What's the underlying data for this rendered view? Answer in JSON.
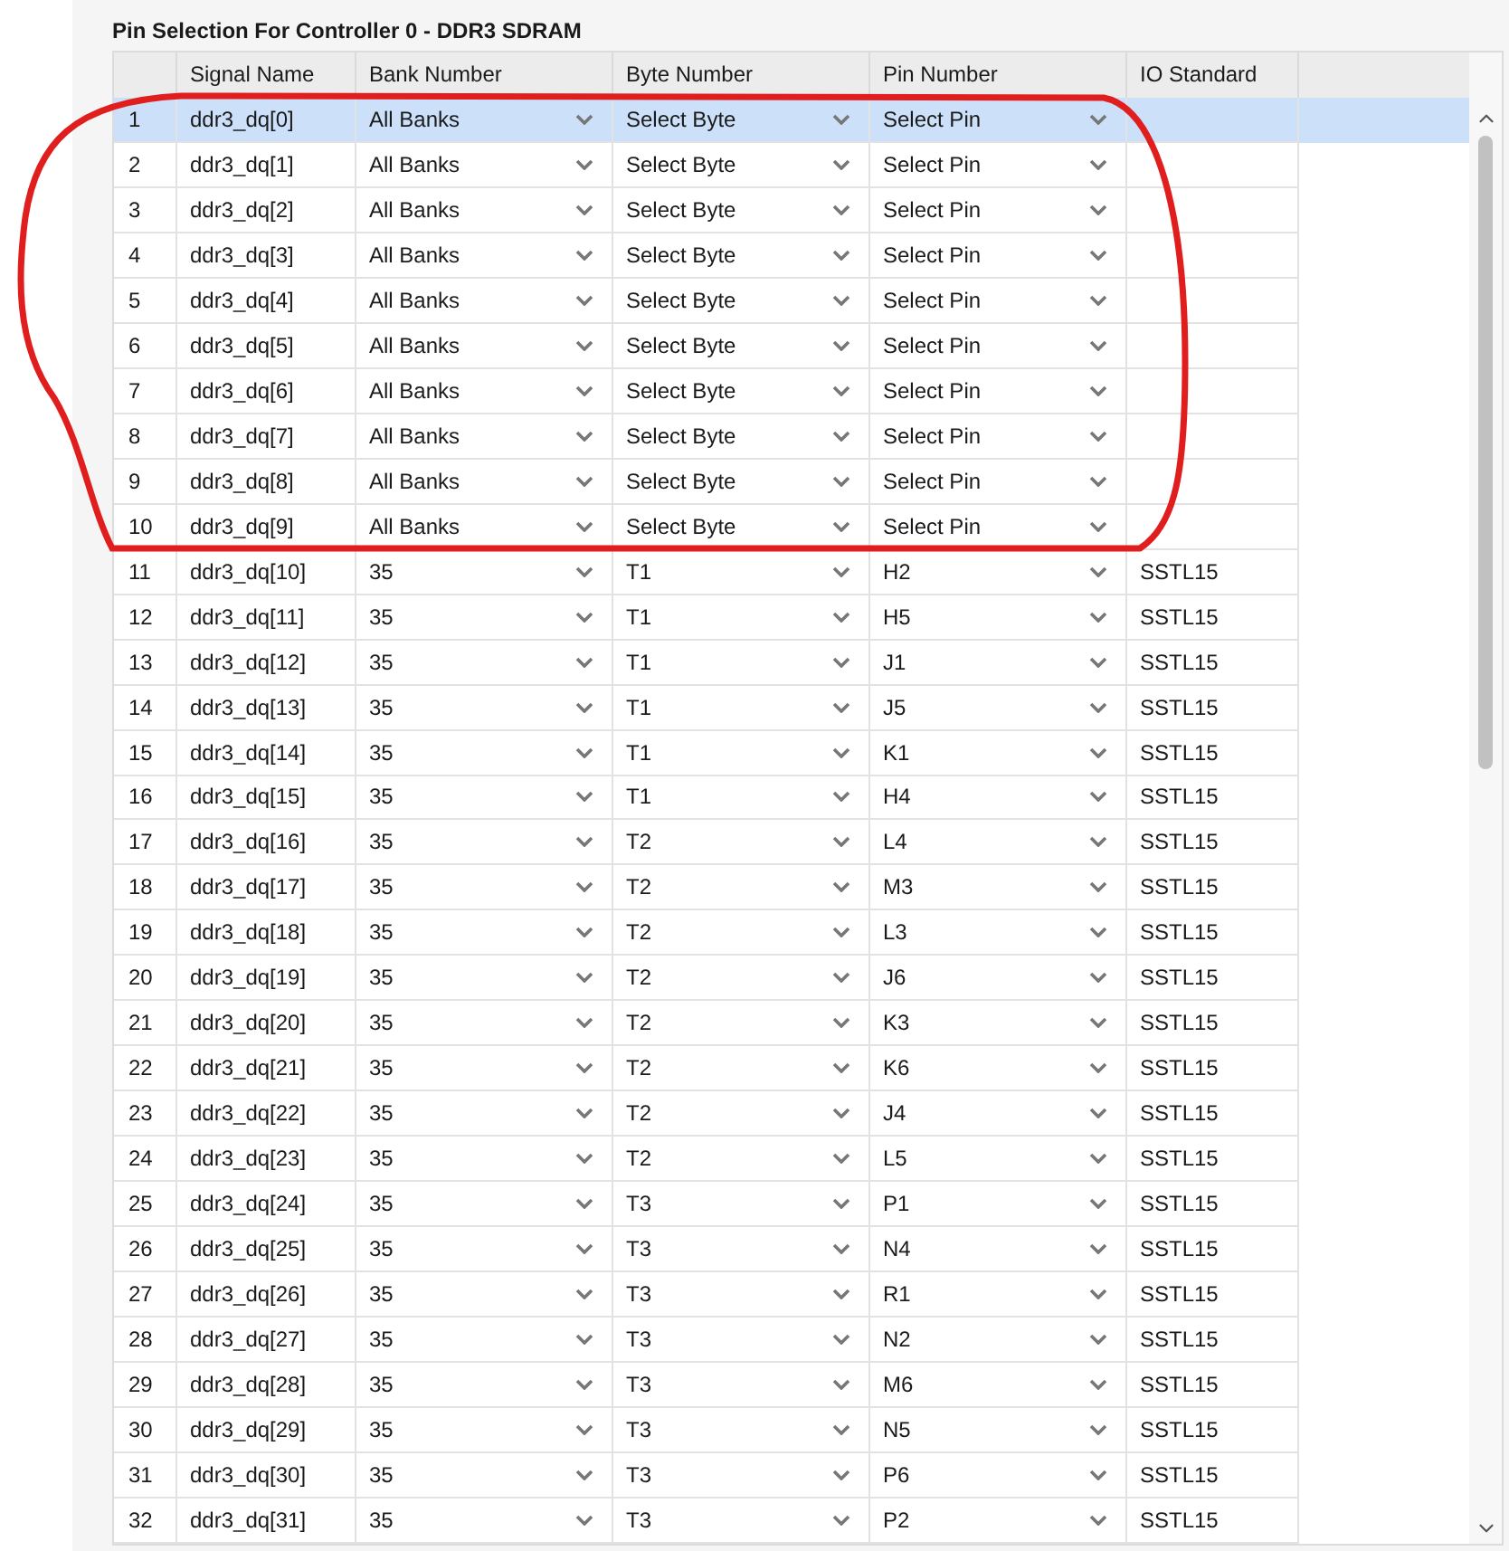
{
  "title": "Pin Selection For Controller 0 - DDR3 SDRAM",
  "columns": [
    "Signal Name",
    "Bank Number",
    "Byte Number",
    "Pin Number",
    "IO Standard"
  ],
  "rows": [
    {
      "index": "1",
      "signal": "ddr3_dq[0]",
      "bank": "All Banks",
      "byte": "Select Byte",
      "pin": "Select Pin",
      "selected": true
    },
    {
      "index": "2",
      "signal": "ddr3_dq[1]",
      "bank": "All Banks",
      "byte": "Select Byte",
      "pin": "Select Pin",
      "selected": false
    },
    {
      "index": "3",
      "signal": "ddr3_dq[2]",
      "bank": "All Banks",
      "byte": "Select Byte",
      "pin": "Select Pin",
      "selected": false
    },
    {
      "index": "4",
      "signal": "ddr3_dq[3]",
      "bank": "All Banks",
      "byte": "Select Byte",
      "pin": "Select Pin",
      "selected": false
    },
    {
      "index": "5",
      "signal": "ddr3_dq[4]",
      "bank": "All Banks",
      "byte": "Select Byte",
      "pin": "Select Pin",
      "selected": false
    },
    {
      "index": "6",
      "signal": "ddr3_dq[5]",
      "bank": "All Banks",
      "byte": "Select Byte",
      "pin": "Select Pin",
      "selected": false
    },
    {
      "index": "7",
      "signal": "ddr3_dq[6]",
      "bank": "All Banks",
      "byte": "Select Byte",
      "pin": "Select Pin",
      "selected": false
    },
    {
      "index": "8",
      "signal": "ddr3_dq[7]",
      "bank": "All Banks",
      "byte": "Select Byte",
      "pin": "Select Pin",
      "selected": false
    },
    {
      "index": "9",
      "signal": "ddr3_dq[8]",
      "bank": "All Banks",
      "byte": "Select Byte",
      "pin": "Select Pin",
      "selected": false
    },
    {
      "index": "10",
      "signal": "ddr3_dq[9]",
      "bank": "All Banks",
      "byte": "Select Byte",
      "pin": "Select Pin",
      "selected": false
    },
    {
      "index": "11",
      "signal": "ddr3_dq[10]",
      "bank": "35",
      "byte": "T1",
      "pin": "H2",
      "io_standard": "SSTL15",
      "selected": false
    },
    {
      "index": "12",
      "signal": "ddr3_dq[11]",
      "bank": "35",
      "byte": "T1",
      "pin": "H5",
      "io_standard": "SSTL15",
      "selected": false
    },
    {
      "index": "13",
      "signal": "ddr3_dq[12]",
      "bank": "35",
      "byte": "T1",
      "pin": "J1",
      "io_standard": "SSTL15",
      "selected": false
    },
    {
      "index": "14",
      "signal": "ddr3_dq[13]",
      "bank": "35",
      "byte": "T1",
      "pin": "J5",
      "io_standard": "SSTL15",
      "selected": false
    },
    {
      "index": "15",
      "signal": "ddr3_dq[14]",
      "bank": "35",
      "byte": "T1",
      "pin": "K1",
      "io_standard": "SSTL15",
      "selected": false
    },
    {
      "index": "16",
      "signal": "ddr3_dq[15]",
      "bank": "35",
      "byte": "T1",
      "pin": "H4",
      "io_standard": "SSTL15",
      "selected": false
    },
    {
      "index": "17",
      "signal": "ddr3_dq[16]",
      "bank": "35",
      "byte": "T2",
      "pin": "L4",
      "io_standard": "SSTL15",
      "selected": false
    },
    {
      "index": "18",
      "signal": "ddr3_dq[17]",
      "bank": "35",
      "byte": "T2",
      "pin": "M3",
      "io_standard": "SSTL15",
      "selected": false
    },
    {
      "index": "19",
      "signal": "ddr3_dq[18]",
      "bank": "35",
      "byte": "T2",
      "pin": "L3",
      "io_standard": "SSTL15",
      "selected": false
    },
    {
      "index": "20",
      "signal": "ddr3_dq[19]",
      "bank": "35",
      "byte": "T2",
      "pin": "J6",
      "io_standard": "SSTL15",
      "selected": false
    },
    {
      "index": "21",
      "signal": "ddr3_dq[20]",
      "bank": "35",
      "byte": "T2",
      "pin": "K3",
      "io_standard": "SSTL15",
      "selected": false
    },
    {
      "index": "22",
      "signal": "ddr3_dq[21]",
      "bank": "35",
      "byte": "T2",
      "pin": "K6",
      "io_standard": "SSTL15",
      "selected": false
    },
    {
      "index": "23",
      "signal": "ddr3_dq[22]",
      "bank": "35",
      "byte": "T2",
      "pin": "J4",
      "io_standard": "SSTL15",
      "selected": false
    },
    {
      "index": "24",
      "signal": "ddr3_dq[23]",
      "bank": "35",
      "byte": "T2",
      "pin": "L5",
      "io_standard": "SSTL15",
      "selected": false
    },
    {
      "index": "25",
      "signal": "ddr3_dq[24]",
      "bank": "35",
      "byte": "T3",
      "pin": "P1",
      "io_standard": "SSTL15",
      "selected": false
    },
    {
      "index": "26",
      "signal": "ddr3_dq[25]",
      "bank": "35",
      "byte": "T3",
      "pin": "N4",
      "io_standard": "SSTL15",
      "selected": false
    },
    {
      "index": "27",
      "signal": "ddr3_dq[26]",
      "bank": "35",
      "byte": "T3",
      "pin": "R1",
      "io_standard": "SSTL15",
      "selected": false
    },
    {
      "index": "28",
      "signal": "ddr3_dq[27]",
      "bank": "35",
      "byte": "T3",
      "pin": "N2",
      "io_standard": "SSTL15",
      "selected": false
    },
    {
      "index": "29",
      "signal": "ddr3_dq[28]",
      "bank": "35",
      "byte": "T3",
      "pin": "M6",
      "io_standard": "SSTL15",
      "selected": false
    },
    {
      "index": "30",
      "signal": "ddr3_dq[29]",
      "bank": "35",
      "byte": "T3",
      "pin": "N5",
      "io_standard": "SSTL15",
      "selected": false
    },
    {
      "index": "31",
      "signal": "ddr3_dq[30]",
      "bank": "35",
      "byte": "T3",
      "pin": "P6",
      "io_standard": "SSTL15",
      "selected": false
    },
    {
      "index": "32",
      "signal": "ddr3_dq[31]",
      "bank": "35",
      "byte": "T3",
      "pin": "P2",
      "io_standard": "SSTL15",
      "selected": false
    }
  ]
}
